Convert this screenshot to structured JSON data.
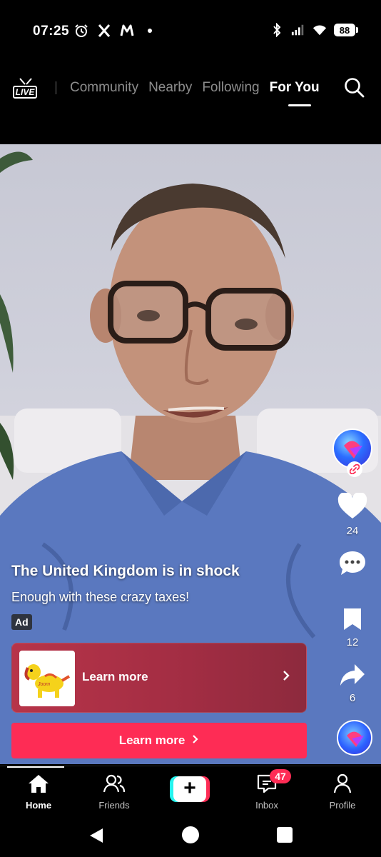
{
  "status_bar": {
    "time": "07:25",
    "left_icons": [
      "alarm-icon",
      "x-icon",
      "m-icon",
      "dot-icon"
    ],
    "right_icons": [
      "bluetooth-icon",
      "signal-icon",
      "wifi-icon"
    ],
    "battery": "88"
  },
  "top_nav": {
    "live_label": "LIVE",
    "tabs": [
      {
        "label": "Community",
        "active": false
      },
      {
        "label": "Nearby",
        "active": false
      },
      {
        "label": "Following",
        "active": false
      },
      {
        "label": "For You",
        "active": true
      }
    ],
    "search_icon": "search-icon"
  },
  "post": {
    "title": "The United Kingdom is in shock",
    "text": "Enough with these crazy taxes!",
    "ad_label": "Ad"
  },
  "rail": {
    "likes": "24",
    "comments_icon": "comment-icon",
    "bookmarks": "12",
    "shares": "6"
  },
  "ad_card": {
    "label": "Learn more",
    "thumb_text": "Joom"
  },
  "cta": {
    "label": "Learn more",
    "chevron": ">"
  },
  "bottom_nav": {
    "home": "Home",
    "friends": "Friends",
    "create": "+",
    "inbox": "Inbox",
    "inbox_badge": "47",
    "profile": "Profile"
  },
  "colors": {
    "accent": "#fe2c55",
    "cyan": "#25f4ee",
    "ad_card": "#a22d43"
  }
}
